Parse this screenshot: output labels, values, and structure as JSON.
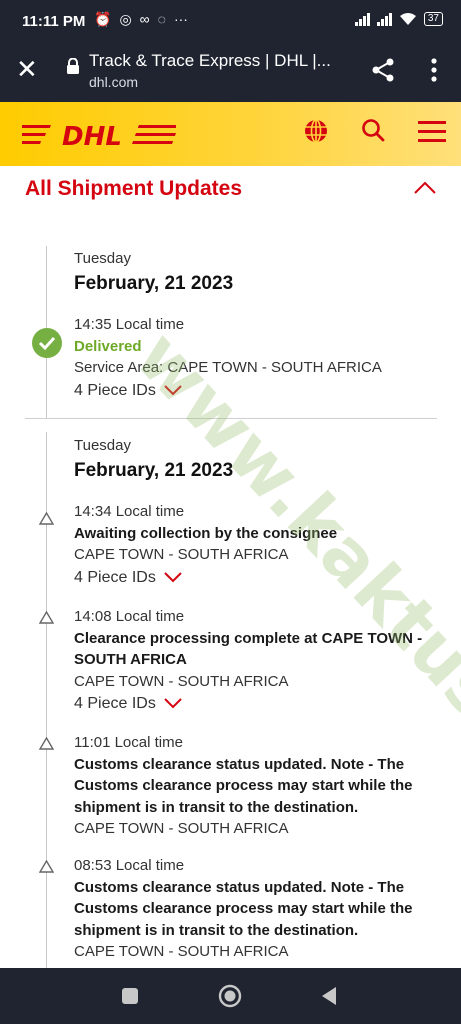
{
  "status_bar": {
    "time": "11:11 PM",
    "battery": "37",
    "notif_icons": [
      "alarm-icon",
      "whatsapp-icon",
      "link-icon",
      "sync-icon",
      "more-dots-icon"
    ]
  },
  "browser": {
    "title": "Track & Trace Express | DHL |...",
    "url": "dhl.com"
  },
  "brand": {
    "logo_text": "DHL",
    "colors": {
      "yellow": "#ffcc00",
      "red": "#d40511",
      "green": "#76b043"
    }
  },
  "section": {
    "title": "All Shipment Updates"
  },
  "groups": [
    {
      "day": "Tuesday",
      "date": "February, 21 2023",
      "events": [
        {
          "time": "14:35 Local time",
          "status": "Delivered",
          "location": "Service Area: CAPE TOWN - SOUTH AFRICA",
          "pieces": "4 Piece IDs"
        }
      ]
    },
    {
      "day": "Tuesday",
      "date": "February, 21 2023",
      "events": [
        {
          "time": "14:34 Local time",
          "description": "Awaiting collection by the consignee",
          "location": "CAPE TOWN - SOUTH AFRICA",
          "pieces": "4 Piece IDs"
        },
        {
          "time": "14:08 Local time",
          "description": "Clearance processing complete at CAPE TOWN - SOUTH AFRICA",
          "location": "CAPE TOWN - SOUTH AFRICA",
          "pieces": "4 Piece IDs"
        },
        {
          "time": "11:01 Local time",
          "description": "Customs clearance status updated. Note - The Customs clearance process may start while the shipment is in transit to the destination.",
          "location": "CAPE TOWN - SOUTH AFRICA"
        },
        {
          "time": "08:53 Local time",
          "description": "Customs clearance status updated. Note - The Customs clearance process may start while the shipment is in transit to the destination.",
          "location": "CAPE TOWN - SOUTH AFRICA"
        }
      ]
    }
  ],
  "watermark": "www.kaktus.id"
}
